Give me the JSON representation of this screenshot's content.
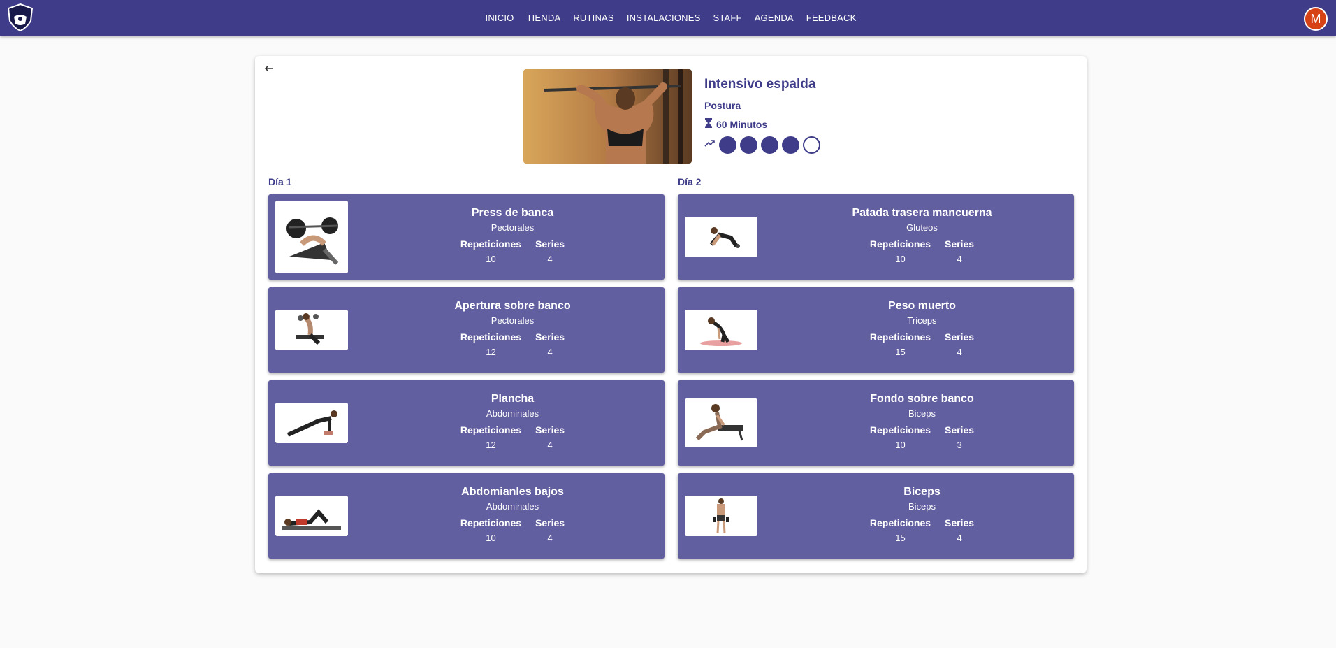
{
  "nav": {
    "links": [
      "INICIO",
      "TIENDA",
      "RUTINAS",
      "INSTALACIONES",
      "STAFF",
      "AGENDA",
      "FEEDBACK"
    ],
    "avatar_letter": "M",
    "logo_text": "GYM ITS"
  },
  "routine": {
    "title": "Intensivo espalda",
    "category": "Postura",
    "duration": "60 Minutos",
    "difficulty": 4,
    "difficulty_max": 5
  },
  "days": [
    {
      "title": "Día 1",
      "exercises": [
        {
          "name": "Press de banca",
          "muscle": "Pectorales",
          "reps_label": "Repeticiones",
          "series_label": "Series",
          "reps": "10",
          "series": "4"
        },
        {
          "name": "Apertura sobre banco",
          "muscle": "Pectorales",
          "reps_label": "Repeticiones",
          "series_label": "Series",
          "reps": "12",
          "series": "4"
        },
        {
          "name": "Plancha",
          "muscle": "Abdominales",
          "reps_label": "Repeticiones",
          "series_label": "Series",
          "reps": "12",
          "series": "4"
        },
        {
          "name": "Abdomianles bajos",
          "muscle": "Abdominales",
          "reps_label": "Repeticiones",
          "series_label": "Series",
          "reps": "10",
          "series": "4"
        }
      ]
    },
    {
      "title": "Día 2",
      "exercises": [
        {
          "name": "Patada trasera mancuerna",
          "muscle": "Gluteos",
          "reps_label": "Repeticiones",
          "series_label": "Series",
          "reps": "10",
          "series": "4"
        },
        {
          "name": "Peso muerto",
          "muscle": "Triceps",
          "reps_label": "Repeticiones",
          "series_label": "Series",
          "reps": "15",
          "series": "4"
        },
        {
          "name": "Fondo sobre banco",
          "muscle": "Biceps",
          "reps_label": "Repeticiones",
          "series_label": "Series",
          "reps": "10",
          "series": "3"
        },
        {
          "name": "Biceps",
          "muscle": "Biceps",
          "reps_label": "Repeticiones",
          "series_label": "Series",
          "reps": "15",
          "series": "4"
        }
      ]
    }
  ],
  "colors": {
    "primary": "#3f3d89",
    "card": "#625fa0",
    "avatar": "#d84315"
  }
}
